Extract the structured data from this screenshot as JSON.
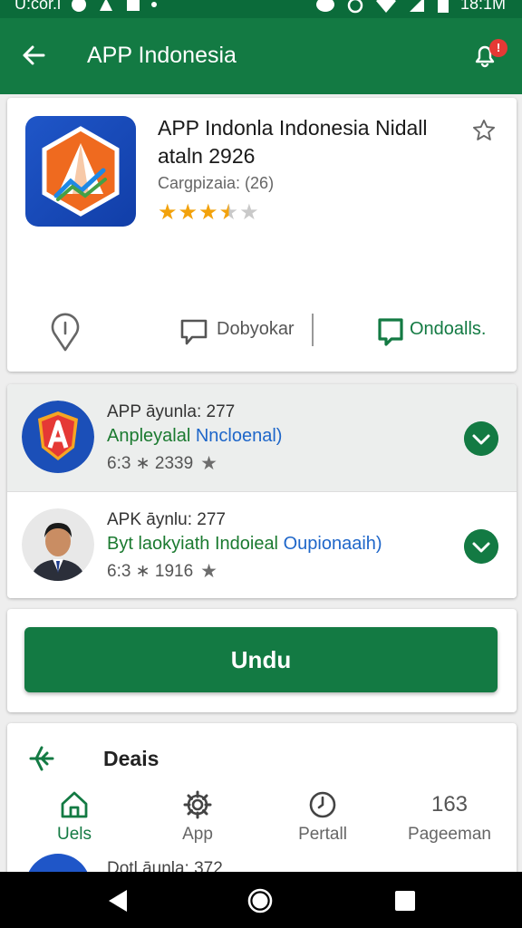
{
  "status_bar": {
    "carrier": "U:cor.i",
    "time": "18:1M"
  },
  "app_bar": {
    "title": "APP Indonesia",
    "notification_count": "!"
  },
  "app": {
    "title": "APP Indonla Indonesia Nidall ataln 2926",
    "category": "Cargpizaia: (26)",
    "rating": 3.5,
    "actions": {
      "comments_label": "Dobyokar",
      "download_label": "Ondoalls."
    }
  },
  "list": [
    {
      "line1": "APP āyunla: 277",
      "line2_main": "Anpleyalal",
      "line2_accent": "Nncloenal)",
      "stat": "6:3 ∗ 2339"
    },
    {
      "line1": "APK āynlu: 277",
      "line2_main": "Byt laokyiath Indoieal",
      "line2_accent": "Oupionaaih)",
      "stat": "6:3 ∗ 1916"
    }
  ],
  "primary_button": {
    "label": "Undu"
  },
  "deals": {
    "title": "Deais",
    "tabs": [
      {
        "label": "Uels",
        "icon": "home-icon"
      },
      {
        "label": "App",
        "icon": "gear-icon"
      },
      {
        "label": "Pertall",
        "icon": "clock-icon"
      },
      {
        "label": "Pageeman",
        "value": "163"
      }
    ],
    "peek_text": "Dotl āunla: 372"
  },
  "colors": {
    "primary": "#137a43",
    "status_bar": "#0b6b3a",
    "accent_blue": "#1e66c9",
    "star": "#f2a20c",
    "badge": "#e53935"
  }
}
